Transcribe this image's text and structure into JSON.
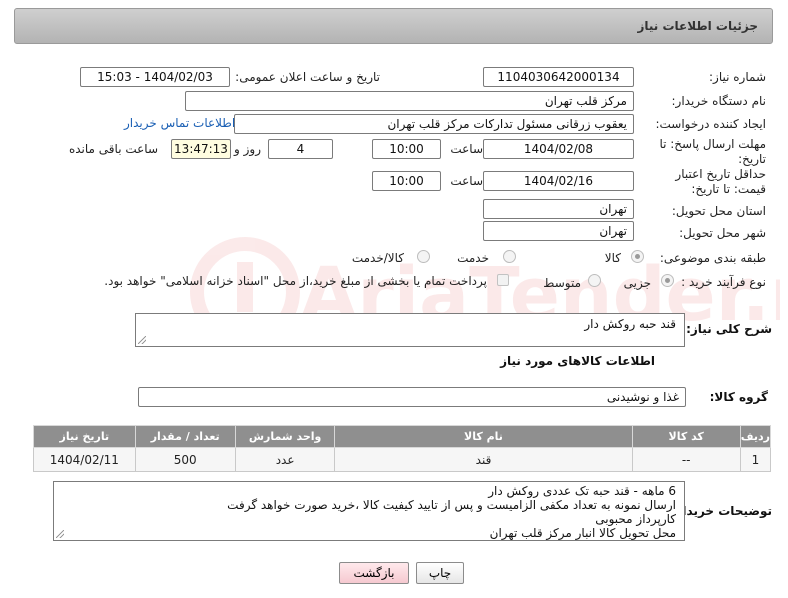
{
  "header": {
    "title": "جزئیات اطلاعات نیاز"
  },
  "form": {
    "need_number_label": "شماره نیاز:",
    "need_number": "1104030642000134",
    "announce_label": "تاریخ و ساعت اعلان عمومی:",
    "announce_value": "1404/02/03 - 15:03",
    "buyer_org_label": "نام دستگاه خریدار:",
    "buyer_org": "مرکز قلب تهران",
    "creator_label": "ایجاد کننده درخواست:",
    "creator": "یعقوب زرقانی مسئول تداركات مركز قلب تهران",
    "contact_link": "اطلاعات تماس خریدار",
    "reply_deadline_label": "مهلت ارسال پاسخ: تا تاریخ:",
    "reply_date": "1404/02/08",
    "time_label": "ساعت",
    "reply_time": "10:00",
    "days_value": "4",
    "days_label": "روز و",
    "remaining_time": "13:47:13",
    "remaining_label": "ساعت باقی مانده",
    "price_validity_label": "حداقل تاریخ اعتبار قیمت: تا تاریخ:",
    "validity_date": "1404/02/16",
    "validity_time": "10:00",
    "province_label": "استان محل تحویل:",
    "province": "تهران",
    "city_label": "شهر محل تحویل:",
    "city": "تهران",
    "category_label": "طبقه بندی موضوعی:",
    "category_options": [
      "کالا",
      "خدمت",
      "کالا/خدمت"
    ],
    "process_label": "نوع فرآیند خرید :",
    "process_options": [
      "جزیی",
      "متوسط"
    ],
    "payment_note": "پرداخت تمام یا بخشی از مبلغ خرید،از محل \"اسناد خزانه اسلامی\" خواهد بود."
  },
  "summary": {
    "label": "شرح کلی نیاز:",
    "text": "قند حبه روکش دار"
  },
  "goods": {
    "section_title": "اطلاعات کالاهای مورد نیاز",
    "group_label": "گروه کالا:",
    "group_value": "غذا و نوشیدنی",
    "columns": [
      "ردیف",
      "کد کالا",
      "نام کالا",
      "واحد شمارش",
      "تعداد / مقدار",
      "تاریخ نیاز"
    ],
    "rows": [
      {
        "row": "1",
        "code": "--",
        "name": "قند",
        "unit": "عدد",
        "qty": "500",
        "date": "1404/02/11"
      }
    ]
  },
  "buyer_notes": {
    "label": "توضیحات خریدار:",
    "lines": [
      "6 ماهه - قند حبه تک عددی روکش دار",
      "ارسال نمونه به تعداد مکفی الزامیست و پس از تایید کیفیت کالا ،خرید صورت خواهد گرفت",
      "کارپرداز محبوبی",
      "محل تحویل کالا انبار مرکز قلب تهران"
    ]
  },
  "buttons": {
    "print": "چاپ",
    "back": "بازگشت"
  },
  "watermark": {
    "brand": "AriaTender.neT"
  },
  "colors": {
    "header_bg": "#c2c2c2",
    "table_header": "#8f8f8f",
    "link": "#1a5fb4",
    "back_button": "#f6c9d0",
    "watermark": "#e15a5a"
  }
}
